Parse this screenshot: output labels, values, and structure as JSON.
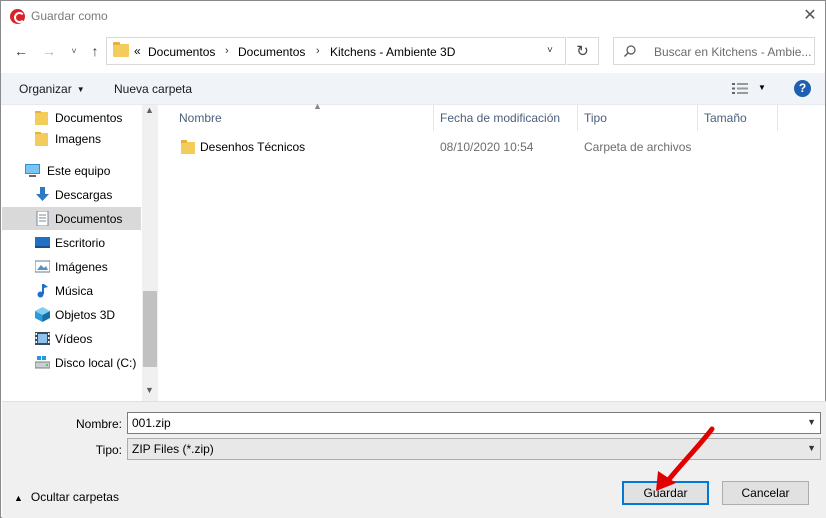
{
  "window": {
    "title": "Guardar como",
    "close_glyph": "✕"
  },
  "navigation": {
    "back_glyph": "←",
    "forward_glyph": "→",
    "recent_glyph": "˅",
    "up_glyph": "↑",
    "overflow_glyph": "«",
    "breadcrumbs": [
      "Documentos",
      "Documentos",
      "Kitchens - Ambiente 3D"
    ],
    "separator": "›",
    "dropdown_glyph": "˅",
    "refresh_glyph": "↻"
  },
  "search": {
    "placeholder": "Buscar en Kitchens - Ambie..."
  },
  "toolbar": {
    "organize_label": "Organizar",
    "new_folder_label": "Nueva carpeta",
    "help_glyph": "?"
  },
  "sidebar": {
    "items": [
      {
        "label": "Documentos",
        "icon": "folder-icon"
      },
      {
        "label": "Imagens",
        "icon": "folder-icon"
      },
      {
        "label": "Este equipo",
        "icon": "computer-icon"
      },
      {
        "label": "Descargas",
        "icon": "download-icon"
      },
      {
        "label": "Documentos",
        "icon": "documents-icon",
        "selected": true
      },
      {
        "label": "Escritorio",
        "icon": "desktop-icon"
      },
      {
        "label": "Imágenes",
        "icon": "pictures-icon"
      },
      {
        "label": "Música",
        "icon": "music-icon"
      },
      {
        "label": "Objetos 3D",
        "icon": "objects-3d-icon"
      },
      {
        "label": "Vídeos",
        "icon": "videos-icon"
      },
      {
        "label": "Disco local (C:)",
        "icon": "drive-icon"
      }
    ]
  },
  "file_list": {
    "columns": [
      "Nombre",
      "Fecha de modificación",
      "Tipo",
      "Tamaño"
    ],
    "rows": [
      {
        "name": "Desenhos Técnicos",
        "modified": "08/10/2020 10:54",
        "type": "Carpeta de archivos",
        "size": ""
      }
    ]
  },
  "save_form": {
    "filename_label": "Nombre:",
    "filename_value": "001.zip",
    "filetype_label": "Tipo:",
    "filetype_value": "ZIP Files (*.zip)",
    "hide_folders_label": "Ocultar carpetas",
    "save_label": "Guardar",
    "cancel_label": "Cancelar"
  },
  "colors": {
    "accent": "#0078d7",
    "selection": "#d9d9d9",
    "annotation_arrow": "#e00000"
  }
}
